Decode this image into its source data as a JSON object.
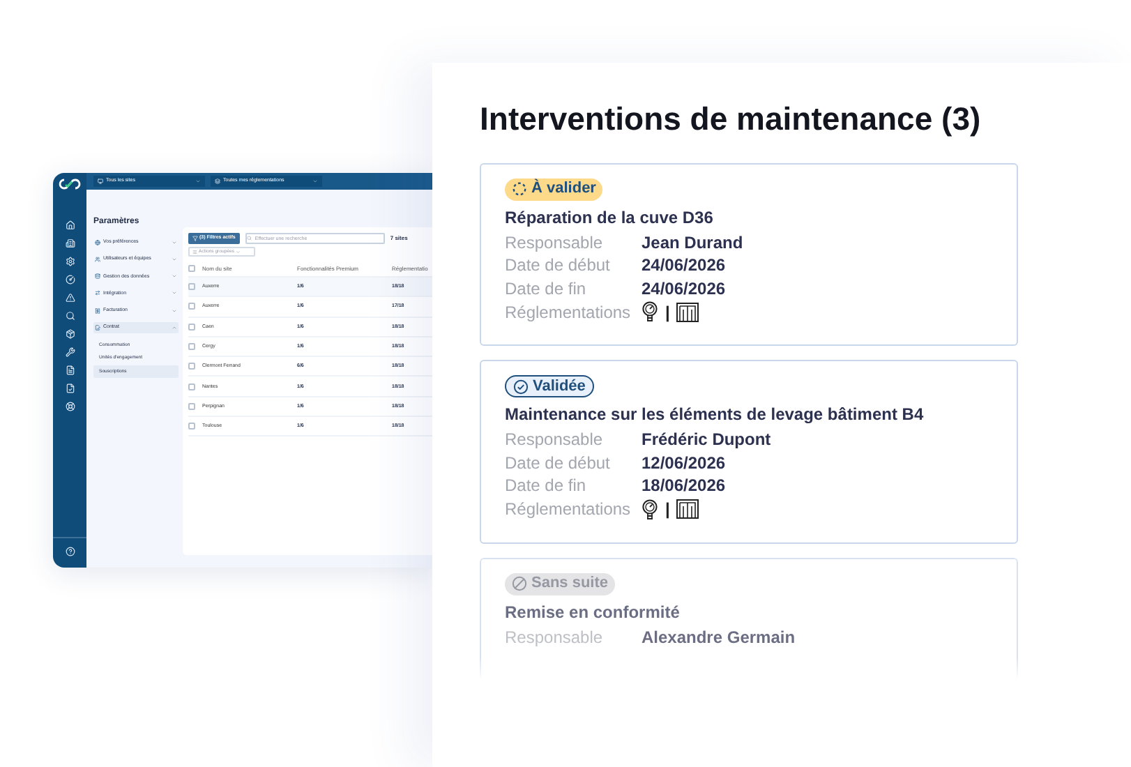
{
  "app": {
    "header": {
      "site_filter": "Tous les sites",
      "regulation_filter": "Toutes mes réglementations"
    },
    "settings": {
      "title": "Paramètres",
      "items": [
        {
          "label": "Vos préférences",
          "expanded": false
        },
        {
          "label": "Utilisateurs et équipes",
          "expanded": false
        },
        {
          "label": "Gestion des données",
          "expanded": false
        },
        {
          "label": "Intégration",
          "expanded": false
        },
        {
          "label": "Facturation",
          "expanded": false
        },
        {
          "label": "Contrat",
          "expanded": true,
          "children": [
            {
              "label": "Consommation",
              "selected": false
            },
            {
              "label": "Unités d'engagement",
              "selected": false
            },
            {
              "label": "Souscriptions",
              "selected": true
            }
          ]
        }
      ]
    },
    "toolbar": {
      "filter_button": "(3) Filtres actifs",
      "search": {
        "placeholder": "Effectuer une recherche"
      },
      "count": "7 sites",
      "bulk_actions": "Actions groupées"
    },
    "table": {
      "all_checked": false,
      "columns": [
        "Nom du site",
        "Fonctionnalités Premium",
        "Réglementatio"
      ],
      "rows": [
        {
          "checked": false,
          "cells": [
            "Auxerre",
            "1/6",
            "18/18"
          ]
        },
        {
          "checked": false,
          "cells": [
            "Auxerre",
            "1/6",
            "17/18"
          ]
        },
        {
          "checked": false,
          "cells": [
            "Caen",
            "1/6",
            "18/18"
          ]
        },
        {
          "checked": false,
          "cells": [
            "Cergy",
            "1/6",
            "18/18"
          ]
        },
        {
          "checked": false,
          "cells": [
            "Clermont Ferrand",
            "6/6",
            "18/18"
          ]
        },
        {
          "checked": false,
          "cells": [
            "Nantes",
            "1/6",
            "18/18"
          ]
        },
        {
          "checked": false,
          "cells": [
            "Perpignan",
            "1/6",
            "18/18"
          ]
        },
        {
          "checked": false,
          "cells": [
            "Toulouse",
            "1/6",
            "18/18"
          ]
        }
      ]
    }
  },
  "panel": {
    "title": "Interventions de maintenance (3)",
    "cards": [
      {
        "status": {
          "kind": "pending",
          "label": "À valider"
        },
        "faded": false,
        "title": "Réparation de la cuve D36",
        "fields": [
          {
            "label": "Responsable",
            "value": "Jean Durand"
          },
          {
            "label": "Date de début",
            "value": "24/06/2026"
          },
          {
            "label": "Date de fin",
            "value": "24/06/2026"
          }
        ],
        "regulations": {
          "label": "Réglementations",
          "separator": "|"
        }
      },
      {
        "status": {
          "kind": "validated",
          "label": "Validée"
        },
        "faded": false,
        "title": "Maintenance sur les éléments de levage bâtiment B4",
        "fields": [
          {
            "label": "Responsable",
            "value": "Frédéric Dupont"
          },
          {
            "label": "Date de début",
            "value": "12/06/2026"
          },
          {
            "label": "Date de fin",
            "value": "18/06/2026"
          }
        ],
        "regulations": {
          "label": "Réglementations",
          "separator": "|"
        }
      },
      {
        "status": {
          "kind": "dismissed",
          "label": "Sans suite"
        },
        "faded": true,
        "title": "Remise en conformité",
        "fields": [
          {
            "label": "Responsable",
            "value": "Alexandre Germain"
          }
        ]
      }
    ]
  }
}
